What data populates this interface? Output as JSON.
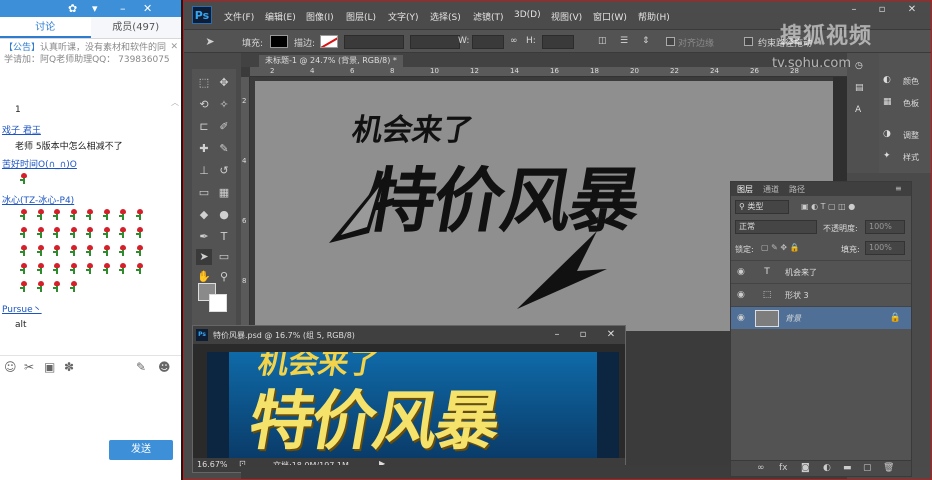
{
  "chat": {
    "tabs": [
      {
        "label": "讨论",
        "active": true
      },
      {
        "label": "成员(497)",
        "active": false
      }
    ],
    "notice": {
      "tag": "【公告】",
      "text": "认真听课，没有素材和软件的同学请加：阿Q老师助理QQ： 739836075"
    },
    "messages": [
      {
        "type": "text",
        "text": "1"
      },
      {
        "type": "name",
        "text": "戏子 君王"
      },
      {
        "type": "text",
        "text": "老师 5版本中怎么相减不了"
      },
      {
        "type": "name",
        "text": "苦好时间O(∩_∩)O"
      },
      {
        "type": "name",
        "text": "冰心(TZ-冰心-P4)"
      },
      {
        "type": "name",
        "text": "Pursue丶"
      },
      {
        "type": "text",
        "text": "alt"
      }
    ],
    "send_label": "发送",
    "accent": "#3d8fd8"
  },
  "ps": {
    "logo": "Ps",
    "menus": [
      "文件(F)",
      "编辑(E)",
      "图像(I)",
      "图层(L)",
      "文字(Y)",
      "选择(S)",
      "滤镜(T)",
      "3D(D)",
      "视图(V)",
      "窗口(W)",
      "帮助(H)"
    ],
    "options": {
      "fill_label": "填充:",
      "stroke_label": "描边:",
      "w_label": "W:",
      "h_label": "H:",
      "align_edges": "对齐边缘",
      "constrain_path": "约束路径拖动"
    },
    "doc_tab": "未标题-1 @ 24.7% (背景, RGB/8) *",
    "ruler_numbers": [
      "2",
      "4",
      "6",
      "8",
      "10",
      "12",
      "14",
      "16",
      "18",
      "20",
      "22",
      "24",
      "26",
      "28"
    ],
    "ruler_v_numbers": [
      "2",
      "4",
      "6",
      "8"
    ],
    "artwork": {
      "line1": "机会来了",
      "line2": "特价风暴"
    },
    "second_window": {
      "title": "特价风暴.psd @ 16.7% (组 5, RGB/8)",
      "zoom": "16.67%",
      "doc_size": "文档:18.0M/197.1M"
    },
    "right_panel": [
      {
        "icon": "palette-icon",
        "label": "颜色"
      },
      {
        "icon": "swatches-icon",
        "label": "色板"
      },
      {
        "icon": "adjust-icon",
        "label": "调整"
      },
      {
        "icon": "styles-icon",
        "label": "样式"
      }
    ],
    "layers": {
      "tabs": [
        "图层",
        "通道",
        "路径"
      ],
      "filter": "类型",
      "blend_mode": "正常",
      "opacity_label": "不透明度:",
      "opacity_value": "100%",
      "lock_label": "锁定:",
      "fill_label": "填充:",
      "fill_value": "100%",
      "items": [
        {
          "name": "机会来了",
          "kind": "T",
          "selected": false
        },
        {
          "name": "形状 3",
          "kind": "shape",
          "selected": false
        },
        {
          "name": "背景",
          "kind": "bg",
          "selected": true
        }
      ]
    }
  },
  "watermark": {
    "line1": "搜狐视频",
    "line2": "tv.sohu.com"
  }
}
